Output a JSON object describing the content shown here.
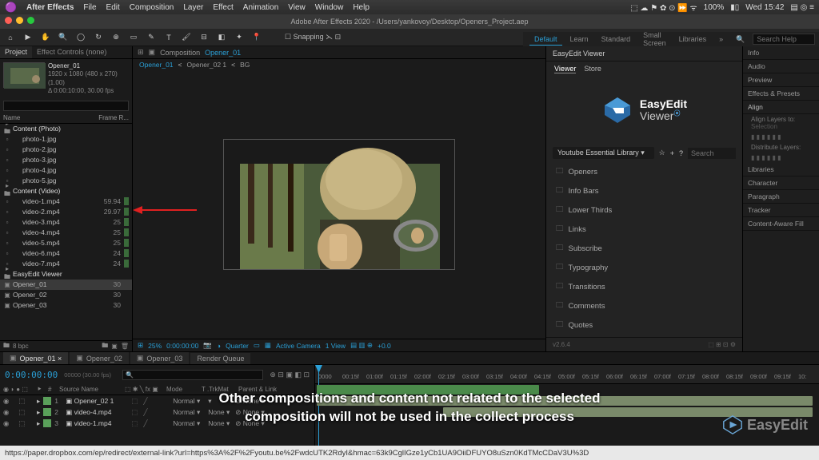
{
  "menubar": {
    "app": "After Effects",
    "items": [
      "File",
      "Edit",
      "Composition",
      "Layer",
      "Effect",
      "Animation",
      "View",
      "Window",
      "Help"
    ],
    "status": {
      "battery": "100%",
      "time": "Wed 15:42"
    }
  },
  "titlebar": {
    "title": "Adobe After Effects 2020 - /Users/yankovoy/Desktop/Openers_Project.aep"
  },
  "toolbar": {
    "snapping": "Snapping"
  },
  "workspace": {
    "items": [
      "Default",
      "Learn",
      "Standard",
      "Small Screen",
      "Libraries"
    ],
    "search_placeholder": "Search Help"
  },
  "project": {
    "tabs": [
      "Project",
      "Effect Controls (none)"
    ],
    "selected": {
      "name": "Opener_01",
      "info1": "1920 x 1080 (480 x 270) (1.00)",
      "info2": "Δ 0:00:10:00, 30.00 fps"
    },
    "search_placeholder": "",
    "columns": [
      "Name",
      "Frame R..."
    ],
    "tree": [
      {
        "type": "folder",
        "name": "Content (Photo)"
      },
      {
        "type": "item",
        "name": "photo-1.jpg",
        "indent": true
      },
      {
        "type": "item",
        "name": "photo-2.jpg",
        "indent": true
      },
      {
        "type": "item",
        "name": "photo-3.jpg",
        "indent": true
      },
      {
        "type": "item",
        "name": "photo-4.jpg",
        "indent": true
      },
      {
        "type": "item",
        "name": "photo-5.jpg",
        "indent": true
      },
      {
        "type": "folder",
        "name": "Content (Video)"
      },
      {
        "type": "item",
        "name": "video-1.mp4",
        "val": "59.94",
        "indent": true,
        "bar": true
      },
      {
        "type": "item",
        "name": "video-2.mp4",
        "val": "29.97",
        "indent": true,
        "bar": true
      },
      {
        "type": "item",
        "name": "video-3.mp4",
        "val": "25",
        "indent": true,
        "bar": true
      },
      {
        "type": "item",
        "name": "video-4.mp4",
        "val": "25",
        "indent": true,
        "bar": true
      },
      {
        "type": "item",
        "name": "video-5.mp4",
        "val": "25",
        "indent": true,
        "bar": true
      },
      {
        "type": "item",
        "name": "video-6.mp4",
        "val": "24",
        "indent": true,
        "bar": true
      },
      {
        "type": "item",
        "name": "video-7.mp4",
        "val": "24",
        "indent": true,
        "bar": true
      },
      {
        "type": "folder",
        "name": "EasyEdit Viewer"
      },
      {
        "type": "comp",
        "name": "Opener_01",
        "val": "30",
        "sel": true
      },
      {
        "type": "comp",
        "name": "Opener_02",
        "val": "30"
      },
      {
        "type": "comp",
        "name": "Opener_03",
        "val": "30"
      }
    ],
    "footer_bpc": "8 bpc"
  },
  "comp": {
    "panel_label": "Composition",
    "crumbs": [
      "Opener_01",
      "Opener_02 1",
      "BG"
    ],
    "footer": {
      "zoom": "25%",
      "time": "0:00:00:00",
      "res": "Quarter",
      "camera": "Active Camera",
      "view": "1 View",
      "exposure": "+0.0"
    }
  },
  "plugin": {
    "title": "EasyEdit Viewer",
    "tabs": [
      "Viewer",
      "Store"
    ],
    "brand": "EasyEdit",
    "brand_sub": "Viewer",
    "library": "Youtube Essential Library",
    "search_placeholder": "Search",
    "categories": [
      "Openers",
      "Info Bars",
      "Lower Thirds",
      "Links",
      "Subscribe",
      "Typography",
      "Transitions",
      "Comments",
      "Quotes"
    ],
    "version": "v2.6.4"
  },
  "right_panels": {
    "items": [
      "Info",
      "Audio",
      "Preview",
      "Effects & Presets",
      "Align",
      "Libraries",
      "Character",
      "Paragraph",
      "Tracker",
      "Content-Aware Fill"
    ],
    "align_label": "Align Layers to:",
    "align_value": "Selection",
    "distribute_label": "Distribute Layers:"
  },
  "timeline": {
    "tabs": [
      {
        "label": "Opener_01",
        "sel": true
      },
      {
        "label": "Opener_02"
      },
      {
        "label": "Opener_03"
      },
      {
        "label": "Render Queue"
      }
    ],
    "timecode": "0:00:00:00",
    "frameinfo": "00000 (30.00 fps)",
    "col_headers": [
      "#",
      "Source Name",
      "Mode",
      "T .TrkMat",
      "Parent & Link"
    ],
    "layers": [
      {
        "num": "1",
        "name": "Opener_02 1",
        "color": "#5aa05a",
        "mode": "Normal",
        "trk": "",
        "parent": "None"
      },
      {
        "num": "2",
        "name": "video-4.mp4",
        "color": "#5aa05a",
        "mode": "Normal",
        "trk": "None",
        "parent": "None"
      },
      {
        "num": "3",
        "name": "video-1.mp4",
        "color": "#5aa05a",
        "mode": "Normal",
        "trk": "None",
        "parent": "None"
      }
    ],
    "ruler_ticks": [
      "0000",
      "00:15f",
      "01:00f",
      "01:15f",
      "02:00f",
      "02:15f",
      "03:00f",
      "03:15f",
      "04:00f",
      "04:15f",
      "05:00f",
      "05:15f",
      "06:00f",
      "06:15f",
      "07:00f",
      "07:15f",
      "08:00f",
      "08:15f",
      "09:00f",
      "09:15f",
      "10:"
    ]
  },
  "caption": {
    "line1": "Other compositions and content not related to the selected",
    "line2": "composition will not be used in the collect process"
  },
  "watermark": "EasyEdit",
  "statusbar": "https://paper.dropbox.com/ep/redirect/external-link?url=https%3A%2F%2Fyoutu.be%2FwdcUTK2RdyI&hmac=63k9CglIGze1yCb1UA9OiiDFUYO8uSzn0KdTMcCDaV3U%3D"
}
